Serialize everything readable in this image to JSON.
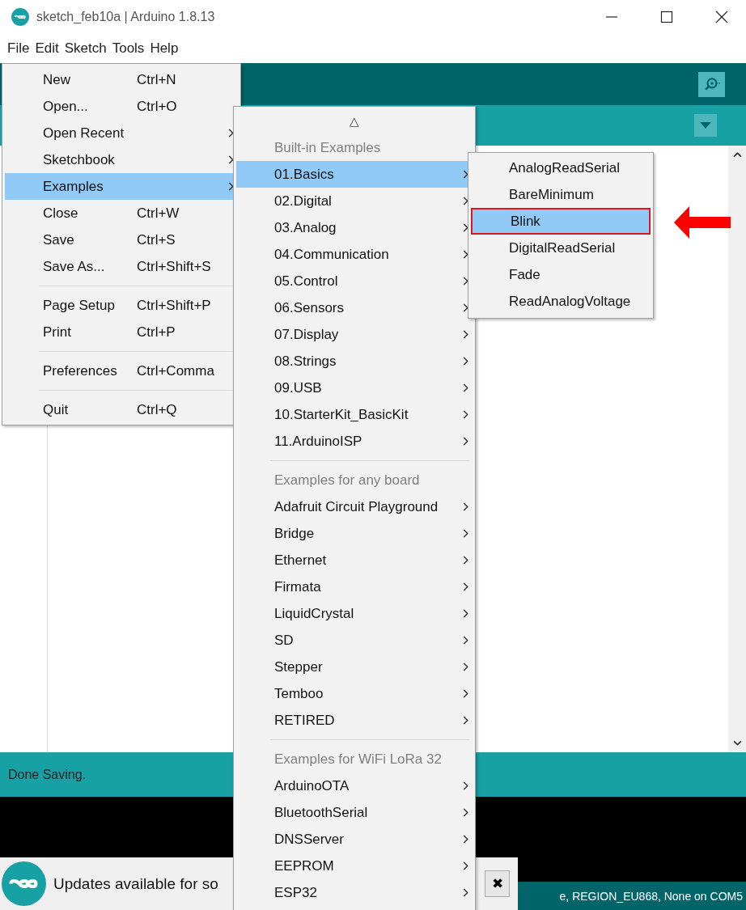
{
  "window": {
    "title": "sketch_feb10a | Arduino 1.8.13"
  },
  "menu_bar": [
    {
      "label": "File"
    },
    {
      "label": "Edit"
    },
    {
      "label": "Sketch"
    },
    {
      "label": "Tools"
    },
    {
      "label": "Help"
    }
  ],
  "file_menu": [
    {
      "kind": "item",
      "label": "New",
      "shortcut": "Ctrl+N",
      "submenu": false,
      "selected": false
    },
    {
      "kind": "item",
      "label": "Open...",
      "shortcut": "Ctrl+O",
      "submenu": false,
      "selected": false
    },
    {
      "kind": "item",
      "label": "Open Recent",
      "submenu": true,
      "selected": false
    },
    {
      "kind": "item",
      "label": "Sketchbook",
      "submenu": true,
      "selected": false
    },
    {
      "kind": "item",
      "label": "Examples",
      "submenu": true,
      "selected": true
    },
    {
      "kind": "item",
      "label": "Close",
      "shortcut": "Ctrl+W",
      "submenu": false,
      "selected": false
    },
    {
      "kind": "item",
      "label": "Save",
      "shortcut": "Ctrl+S",
      "submenu": false,
      "selected": false
    },
    {
      "kind": "item",
      "label": "Save As...",
      "shortcut": "Ctrl+Shift+S",
      "submenu": false,
      "selected": false
    },
    {
      "kind": "separator"
    },
    {
      "kind": "item",
      "label": "Page Setup",
      "shortcut": "Ctrl+Shift+P",
      "submenu": false,
      "selected": false
    },
    {
      "kind": "item",
      "label": "Print",
      "shortcut": "Ctrl+P",
      "submenu": false,
      "selected": false
    },
    {
      "kind": "separator"
    },
    {
      "kind": "item",
      "label": "Preferences",
      "shortcut": "Ctrl+Comma",
      "submenu": false,
      "selected": false
    },
    {
      "kind": "separator"
    },
    {
      "kind": "item",
      "label": "Quit",
      "shortcut": "Ctrl+Q",
      "submenu": false,
      "selected": false
    }
  ],
  "examples_menu": {
    "scroll_up": "△",
    "items": [
      {
        "kind": "header",
        "label": "Built-in Examples"
      },
      {
        "kind": "item",
        "label": "01.Basics",
        "submenu": true,
        "selected": true
      },
      {
        "kind": "item",
        "label": "02.Digital",
        "submenu": true,
        "selected": false
      },
      {
        "kind": "item",
        "label": "03.Analog",
        "submenu": true,
        "selected": false
      },
      {
        "kind": "item",
        "label": "04.Communication",
        "submenu": true,
        "selected": false
      },
      {
        "kind": "item",
        "label": "05.Control",
        "submenu": true,
        "selected": false
      },
      {
        "kind": "item",
        "label": "06.Sensors",
        "submenu": true,
        "selected": false
      },
      {
        "kind": "item",
        "label": "07.Display",
        "submenu": true,
        "selected": false
      },
      {
        "kind": "item",
        "label": "08.Strings",
        "submenu": true,
        "selected": false
      },
      {
        "kind": "item",
        "label": "09.USB",
        "submenu": true,
        "selected": false
      },
      {
        "kind": "item",
        "label": "10.StarterKit_BasicKit",
        "submenu": true,
        "selected": false
      },
      {
        "kind": "item",
        "label": "11.ArduinoISP",
        "submenu": true,
        "selected": false
      },
      {
        "kind": "separator"
      },
      {
        "kind": "header",
        "label": "Examples for any board"
      },
      {
        "kind": "item",
        "label": "Adafruit Circuit Playground",
        "submenu": true,
        "selected": false
      },
      {
        "kind": "item",
        "label": "Bridge",
        "submenu": true,
        "selected": false
      },
      {
        "kind": "item",
        "label": "Ethernet",
        "submenu": true,
        "selected": false
      },
      {
        "kind": "item",
        "label": "Firmata",
        "submenu": true,
        "selected": false
      },
      {
        "kind": "item",
        "label": "LiquidCrystal",
        "submenu": true,
        "selected": false
      },
      {
        "kind": "item",
        "label": "SD",
        "submenu": true,
        "selected": false
      },
      {
        "kind": "item",
        "label": "Stepper",
        "submenu": true,
        "selected": false
      },
      {
        "kind": "item",
        "label": "Temboo",
        "submenu": true,
        "selected": false
      },
      {
        "kind": "item",
        "label": "RETIRED",
        "submenu": true,
        "selected": false
      },
      {
        "kind": "separator"
      },
      {
        "kind": "header",
        "label": "Examples for WiFi LoRa 32"
      },
      {
        "kind": "item",
        "label": "ArduinoOTA",
        "submenu": true,
        "selected": false
      },
      {
        "kind": "item",
        "label": "BluetoothSerial",
        "submenu": true,
        "selected": false
      },
      {
        "kind": "item",
        "label": "DNSServer",
        "submenu": true,
        "selected": false
      },
      {
        "kind": "item",
        "label": "EEPROM",
        "submenu": true,
        "selected": false
      },
      {
        "kind": "item",
        "label": "ESP32",
        "submenu": true,
        "selected": false
      }
    ]
  },
  "basics_menu": [
    {
      "label": "AnalogReadSerial",
      "selected": false,
      "outlined": false
    },
    {
      "label": "BareMinimum",
      "selected": false,
      "outlined": false
    },
    {
      "label": "Blink",
      "selected": true,
      "outlined": true
    },
    {
      "label": "DigitalReadSerial",
      "selected": false,
      "outlined": false
    },
    {
      "label": "Fade",
      "selected": false,
      "outlined": false
    },
    {
      "label": "ReadAnalogVoltage",
      "selected": false,
      "outlined": false
    }
  ],
  "annotation": {
    "kind": "arrow",
    "color": "#ff0000"
  },
  "status": {
    "message": "Done Saving."
  },
  "notification": {
    "text": "Updates available for so",
    "close": "✖"
  },
  "status_bar": {
    "text": "e, REGION_EU868, None on COM5"
  }
}
